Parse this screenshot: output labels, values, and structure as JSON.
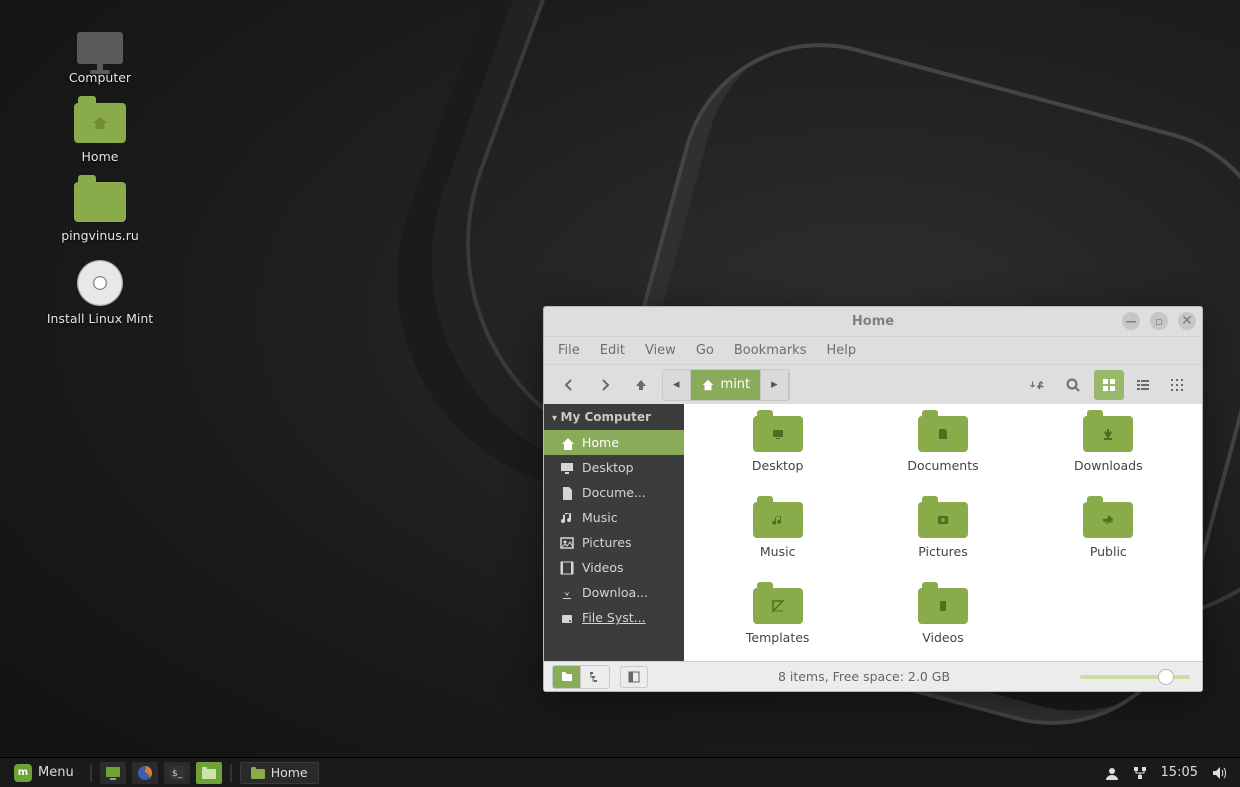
{
  "desktop": {
    "icons": [
      {
        "label": "Computer",
        "type": "computer"
      },
      {
        "label": "Home",
        "type": "home"
      },
      {
        "label": "pingvinus.ru",
        "type": "folder"
      },
      {
        "label": "Install Linux Mint",
        "type": "disc"
      }
    ]
  },
  "window": {
    "title": "Home",
    "menubar": [
      "File",
      "Edit",
      "View",
      "Go",
      "Bookmarks",
      "Help"
    ],
    "path_current": "mint",
    "sidebar": {
      "header": "My Computer",
      "items": [
        {
          "label": "Home",
          "icon": "home",
          "active": true
        },
        {
          "label": "Desktop",
          "icon": "desktop"
        },
        {
          "label": "Docume...",
          "icon": "document"
        },
        {
          "label": "Music",
          "icon": "music"
        },
        {
          "label": "Pictures",
          "icon": "pictures"
        },
        {
          "label": "Videos",
          "icon": "video"
        },
        {
          "label": "Downloa...",
          "icon": "download"
        },
        {
          "label": "File Syst...",
          "icon": "disk",
          "underline": true
        }
      ]
    },
    "files": [
      {
        "label": "Desktop",
        "picto": "desktop"
      },
      {
        "label": "Documents",
        "picto": "document"
      },
      {
        "label": "Downloads",
        "picto": "download"
      },
      {
        "label": "Music",
        "picto": "music"
      },
      {
        "label": "Pictures",
        "picto": "pictures"
      },
      {
        "label": "Public",
        "picto": "public"
      },
      {
        "label": "Templates",
        "picto": "templates"
      },
      {
        "label": "Videos",
        "picto": "video"
      }
    ],
    "status": "8 items, Free space: 2.0 GB"
  },
  "panel": {
    "menu": "Menu",
    "task": "Home",
    "clock": "15:05"
  },
  "colors": {
    "accent": "#8aab5a"
  }
}
